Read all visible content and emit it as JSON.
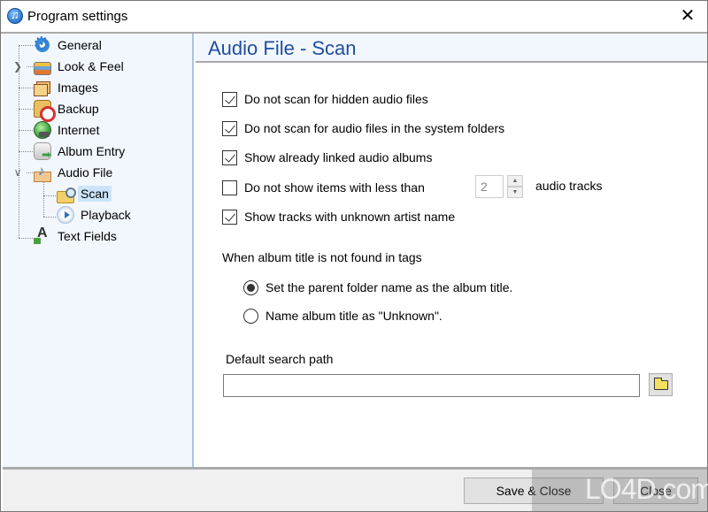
{
  "window": {
    "title": "Program settings",
    "close_icon": "close-x-icon"
  },
  "sidebar": {
    "items": [
      {
        "label": "General",
        "icon": "gear-icon",
        "level": 0
      },
      {
        "label": "Look & Feel",
        "icon": "palette-icon",
        "level": 0,
        "expander": "collapsed"
      },
      {
        "label": "Images",
        "icon": "images-icon",
        "level": 0
      },
      {
        "label": "Backup",
        "icon": "backup-icon",
        "level": 0
      },
      {
        "label": "Internet",
        "icon": "globe-icon",
        "level": 0
      },
      {
        "label": "Album Entry",
        "icon": "album-entry-icon",
        "level": 0
      },
      {
        "label": "Audio File",
        "icon": "audio-file-icon",
        "level": 0,
        "expander": "expanded"
      },
      {
        "label": "Scan",
        "icon": "scan-folder-icon",
        "level": 1,
        "selected": true
      },
      {
        "label": "Playback",
        "icon": "playback-icon",
        "level": 1
      },
      {
        "label": "Text Fields",
        "icon": "text-fields-icon",
        "level": 0
      }
    ],
    "expander_collapsed": "❯",
    "expander_expanded": "∨"
  },
  "main": {
    "title": "Audio File - Scan",
    "options": [
      {
        "label": "Do not scan for hidden audio files",
        "checked": true
      },
      {
        "label": "Do not scan for audio files in the system folders",
        "checked": true
      },
      {
        "label": "Show already linked audio albums",
        "checked": true
      },
      {
        "label": "Do not show items with less than",
        "checked": false
      },
      {
        "label": "Show tracks with unknown artist name",
        "checked": true
      }
    ],
    "min_tracks": {
      "value": "2",
      "suffix": "audio tracks",
      "up": "▲",
      "down": "▼"
    },
    "album_title_section": {
      "label": "When album title is not found in tags",
      "options": [
        {
          "label": "Set the parent folder name as the album title.",
          "selected": true
        },
        {
          "label": "Name album title as \"Unknown\".",
          "selected": false
        }
      ]
    },
    "search_path": {
      "label": "Default search path",
      "value": "",
      "placeholder": ""
    }
  },
  "footer": {
    "save_close_label": "Save & Close",
    "close_label": "Close"
  },
  "watermark": {
    "text": "LO4D.com"
  }
}
